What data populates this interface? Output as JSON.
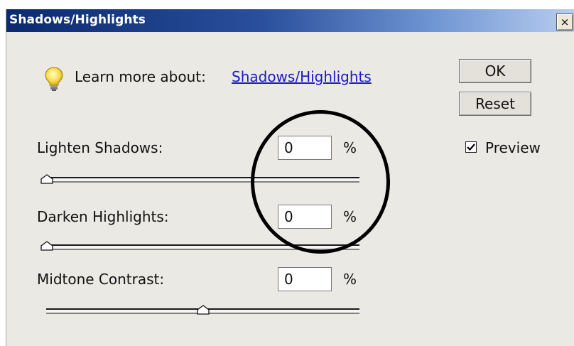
{
  "dialog": {
    "title": "Shadows/Highlights",
    "close_label": "×"
  },
  "learn_more": {
    "label": "Learn more about:",
    "link": "Shadows/Highlights"
  },
  "buttons": {
    "ok": "OK",
    "reset": "Reset"
  },
  "preview": {
    "label": "Preview",
    "checked": true
  },
  "fields": [
    {
      "label": "Lighten Shadows:",
      "value": "0",
      "unit": "%",
      "slider_position": 0.0
    },
    {
      "label": "Darken Highlights:",
      "value": "0",
      "unit": "%",
      "slider_position": 0.0
    },
    {
      "label": "Midtone Contrast:",
      "value": "0",
      "unit": "%",
      "slider_position": 0.5
    }
  ],
  "icons": {
    "tip": "lightbulb-icon",
    "close": "close-icon",
    "check": "checkmark-icon"
  },
  "colors": {
    "title_bar_start": "#0b2a6f",
    "link": "#1a1ac8",
    "annotation_circle": "#000000"
  }
}
